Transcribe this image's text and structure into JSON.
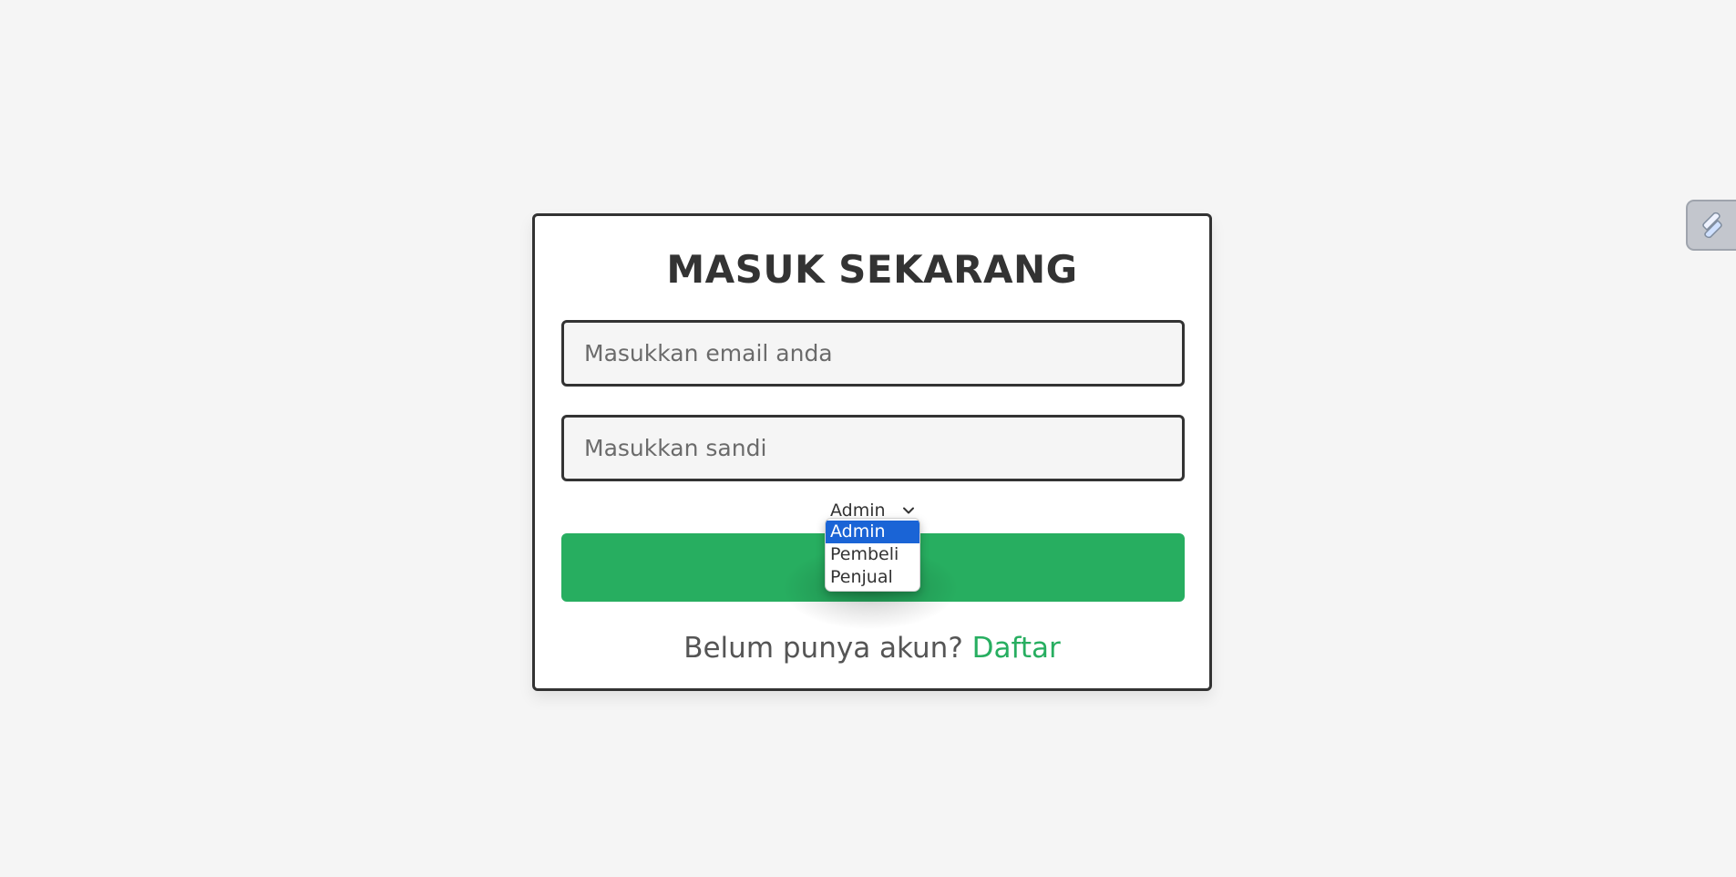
{
  "login": {
    "title": "MASUK SEKARANG",
    "email_placeholder": "Masukkan email anda",
    "password_placeholder": "Masukkan sandi",
    "submit_label": "",
    "footer_text": "Belum punya akun? ",
    "signup_link": "Daftar"
  },
  "role_select": {
    "selected": "Admin",
    "options": [
      "Admin",
      "Pembeli",
      "Penjual"
    ]
  },
  "colors": {
    "accent": "#27ae60",
    "border": "#333333",
    "background": "#f5f5f5",
    "option_highlight": "#1a64d6"
  },
  "icons": {
    "select_arrow": "chevron-down-icon",
    "widget": "extension-icon"
  }
}
